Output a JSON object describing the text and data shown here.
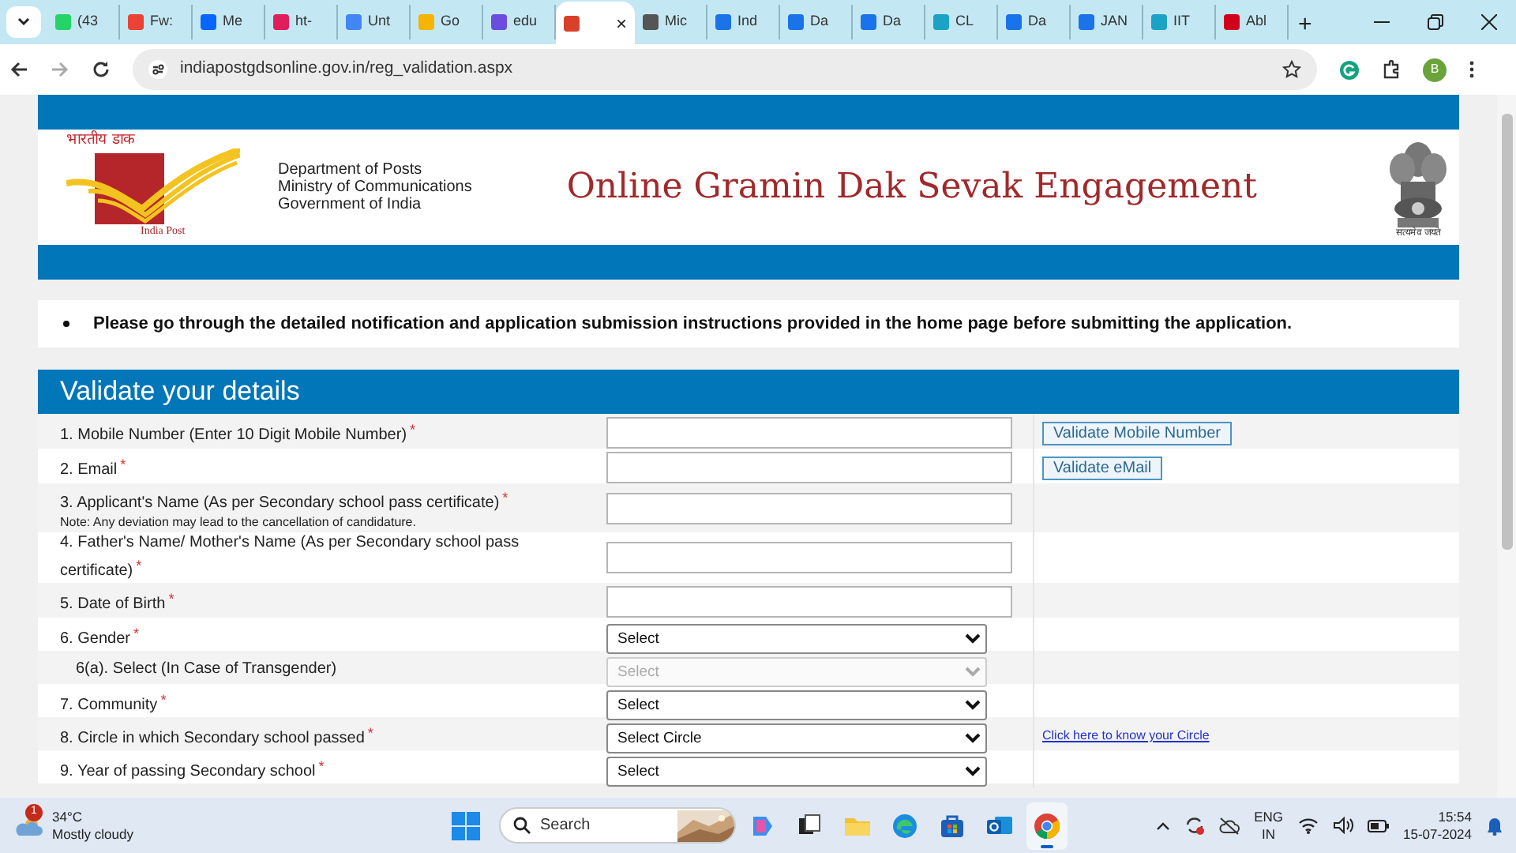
{
  "browser": {
    "tabs": [
      {
        "label": "(43",
        "color": "#25d366",
        "selected": false
      },
      {
        "label": "Fw:",
        "color": "#ea4335",
        "selected": false
      },
      {
        "label": "Me",
        "color": "#0866ff",
        "selected": false
      },
      {
        "label": "ht-",
        "color": "#e01e5a",
        "selected": false
      },
      {
        "label": "Unt",
        "color": "#4285f4",
        "selected": false
      },
      {
        "label": "Go",
        "color": "#f4b400",
        "selected": false
      },
      {
        "label": "edu",
        "color": "#6c4ce0",
        "selected": false
      },
      {
        "close": "×",
        "color": "#d9402b",
        "selected": true
      },
      {
        "label": "Mic",
        "color": "#555555",
        "selected": false
      },
      {
        "label": "Ind",
        "color": "#1a73e8",
        "selected": false
      },
      {
        "label": "Da",
        "color": "#1a73e8",
        "selected": false
      },
      {
        "label": "Da",
        "color": "#1a73e8",
        "selected": false
      },
      {
        "label": "CL",
        "color": "#1ba3c6",
        "selected": false
      },
      {
        "label": "Da",
        "color": "#1a73e8",
        "selected": false
      },
      {
        "label": "JAN",
        "color": "#1a73e8",
        "selected": false
      },
      {
        "label": "IIT",
        "color": "#1ba3c6",
        "selected": false
      },
      {
        "label": "Abl",
        "color": "#d0021b",
        "selected": false
      }
    ],
    "new_tab": "+",
    "url": "indiapostgdsonline.gov.in/reg_validation.aspx",
    "profile": "B"
  },
  "header": {
    "logo_hindi": "भारतीय डाक",
    "logo_caption": "India Post",
    "department": [
      "Department of Posts",
      "Ministry of Communications",
      "Government of India"
    ],
    "title": "Online Gramin Dak Sevak Engagement",
    "emblem_motto": "सत्यमेव जयते"
  },
  "notice": "Please go through the detailed notification and application submission instructions provided in the home page before submitting the application.",
  "form": {
    "title": "Validate your details",
    "rows": [
      {
        "label": "1. Mobile Number (Enter 10 Digit Mobile Number)",
        "mark": "*",
        "indented": false,
        "field": {
          "kind": "text"
        },
        "action": {
          "kind": "button",
          "text": "Validate Mobile Number"
        }
      },
      {
        "label": "2. Email",
        "mark": "*",
        "indented": false,
        "field": {
          "kind": "text"
        },
        "action": {
          "kind": "button",
          "text": "Validate eMail"
        }
      },
      {
        "label": "3. Applicant's Name (As per Secondary school pass certificate)",
        "mark": "*",
        "note": "Note: Any deviation may lead to the cancellation of candidature.",
        "indented": false,
        "field": {
          "kind": "text"
        }
      },
      {
        "label": "4. Father's Name/ Mother's Name (As per Secondary school pass certificate)",
        "mark": "*",
        "indented": false,
        "field": {
          "kind": "text"
        }
      },
      {
        "label": "5. Date of Birth",
        "mark": "*",
        "indented": false,
        "field": {
          "kind": "text"
        }
      },
      {
        "label": "6. Gender",
        "mark": "*",
        "indented": false,
        "field": {
          "kind": "select",
          "value": "Select",
          "disabled": false
        }
      },
      {
        "label": "6(a). Select (In Case of Transgender)",
        "indented": true,
        "field": {
          "kind": "select",
          "value": "Select",
          "disabled": true
        }
      },
      {
        "label": "7. Community",
        "mark": "*",
        "indented": false,
        "field": {
          "kind": "select",
          "value": "Select",
          "disabled": false
        }
      },
      {
        "label": "8. Circle in which Secondary school passed",
        "mark": "*",
        "indented": false,
        "field": {
          "kind": "select",
          "value": "Select Circle",
          "disabled": false
        },
        "action": {
          "kind": "link",
          "text": "Click here to know your Circle"
        }
      },
      {
        "label": "9. Year of passing Secondary school",
        "mark": "*",
        "indented": false,
        "field": {
          "kind": "select",
          "value": "Select",
          "disabled": false
        }
      }
    ]
  },
  "taskbar": {
    "weather": {
      "badge": "1",
      "temp": "34°C",
      "text": "Mostly cloudy"
    },
    "search": "Search",
    "apps": [
      {
        "kind": "copilot",
        "selected": false
      },
      {
        "kind": "taskview",
        "selected": false
      },
      {
        "kind": "folder",
        "selected": false
      },
      {
        "kind": "edge",
        "selected": false
      },
      {
        "kind": "store",
        "selected": false
      },
      {
        "kind": "outlook",
        "selected": false
      },
      {
        "kind": "chrome",
        "selected": true
      }
    ],
    "lang": "ENG",
    "region": "IN",
    "time": "15:54",
    "date": "15-07-2024"
  }
}
